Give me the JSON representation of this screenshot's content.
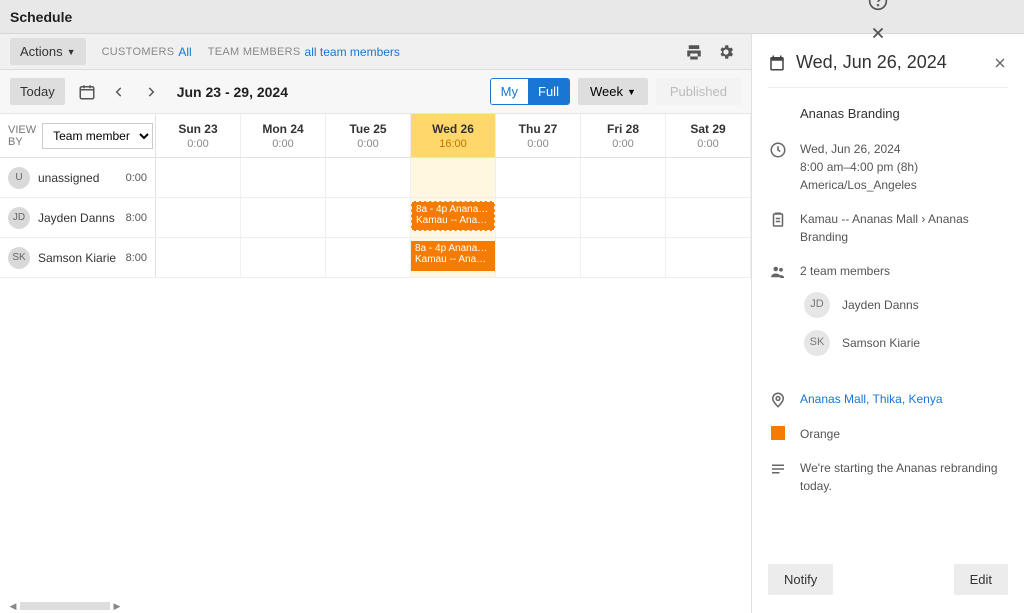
{
  "top": {
    "title": "Schedule"
  },
  "toolbar": {
    "actions_label": "Actions",
    "customers_label": "Customers",
    "customers_value": "All",
    "team_label": "Team members",
    "team_value": "all team members"
  },
  "datebar": {
    "today_label": "Today",
    "range": "Jun 23 - 29, 2024",
    "my_label": "My",
    "full_label": "Full",
    "week_label": "Week",
    "published_label": "Published"
  },
  "grid": {
    "view_by_label": "View by",
    "view_by_value": "Team member",
    "days": [
      {
        "name": "Sun 23",
        "hours": "0:00",
        "highlight": false
      },
      {
        "name": "Mon 24",
        "hours": "0:00",
        "highlight": false
      },
      {
        "name": "Tue 25",
        "hours": "0:00",
        "highlight": false
      },
      {
        "name": "Wed 26",
        "hours": "16:00",
        "highlight": true
      },
      {
        "name": "Thu 27",
        "hours": "0:00",
        "highlight": false
      },
      {
        "name": "Fri 28",
        "hours": "0:00",
        "highlight": false
      },
      {
        "name": "Sat 29",
        "hours": "0:00",
        "highlight": false
      }
    ],
    "rows": [
      {
        "initials": "U",
        "name": "unassigned",
        "hours": "0:00"
      },
      {
        "initials": "JD",
        "name": "Jayden Danns",
        "hours": "8:00"
      },
      {
        "initials": "SK",
        "name": "Samson Kiarie",
        "hours": "8:00"
      }
    ],
    "event": {
      "line1": "8a - 4p Ananas B…",
      "line2": "Kamau -- Ananas…"
    }
  },
  "panel": {
    "date_title": "Wed, Jun 26, 2024",
    "event_title": "Ananas Branding",
    "time_line1": "Wed, Jun 26, 2024",
    "time_line2": "8:00 am–4:00 pm (8h)",
    "time_line3": "America/Los_Angeles",
    "job": "Kamau -- Ananas Mall › Ananas Branding",
    "members_label": "2 team members",
    "member1_initials": "JD",
    "member1_name": "Jayden Danns",
    "member2_initials": "SK",
    "member2_name": "Samson Kiarie",
    "location": "Ananas Mall, Thika, Kenya",
    "color_name": "Orange",
    "note": "We're starting the Ananas rebranding today.",
    "notify_label": "Notify",
    "edit_label": "Edit"
  }
}
